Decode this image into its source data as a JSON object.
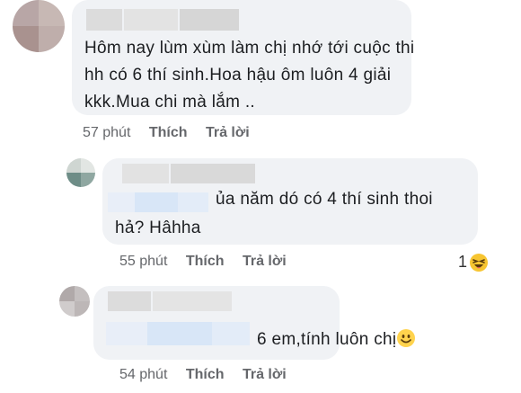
{
  "comments": [
    {
      "text_lines": [
        "Hôm nay lùm xùm làm chị nhớ tới cuộc thi",
        "hh có 6 thí sinh.Hoa hậu ôm luôn 4 giải",
        "kkk.Mua chi mà lắm .."
      ],
      "time": "57 phút",
      "like_label": "Thích",
      "reply_label": "Trả lời"
    },
    {
      "text_lines": [
        "ủa năm dó có 4 thí sinh thoi",
        "hả? Hâhha"
      ],
      "time": "55 phút",
      "like_label": "Thích",
      "reply_label": "Trả lời",
      "reaction_count": "1",
      "reaction_icon": "laughing-emoji-icon"
    },
    {
      "text_lines": [
        "6 em,tính luôn chị"
      ],
      "emoji": "smiling-emoji-icon",
      "time": "54 phút",
      "like_label": "Thích",
      "reply_label": "Trả lời"
    }
  ],
  "colors": {
    "bubble": "#f0f2f5",
    "meta_text": "#65676b",
    "comment_text": "#1c1e21",
    "mention_blur": "#d8e6f7"
  }
}
